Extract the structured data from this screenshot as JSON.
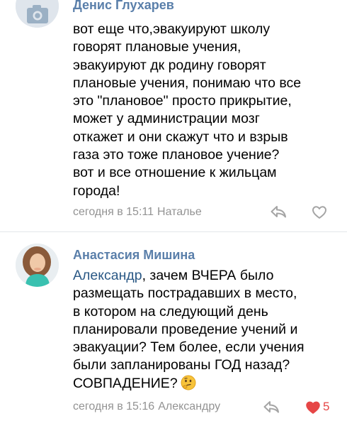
{
  "comments": [
    {
      "author": "Денис Глухарев",
      "text_lines": [
        "вот еще что,эвакуируют школу",
        "говорят плановые учения,",
        "эвакуируют дк родину говорят",
        "плановые учения, понимаю что все",
        "это \"плановое\" просто прикрытие,",
        "может у администрации мозг",
        "откажет и они скажут что и взрыв",
        "газа это тоже плановое учение?",
        "вот и все отношение к жильцам",
        "города!"
      ],
      "time": "сегодня в 15:11",
      "reply_to": "Натальe",
      "avatar_icon": "camera-icon",
      "liked": false
    },
    {
      "author": "Анастасия Мишина",
      "mention": "Александр",
      "text_line1_rest": ", зачем ВЧЕРА было",
      "text_lines": [
        "размещать пострадавших в место,",
        "в котором на следующий день",
        "планировали проведение учений и",
        "эвакуации? Тем более, если учения",
        "были запланированы ГОД назад?"
      ],
      "last_line": "СОВПАДЕНИЕ?",
      "emoji": "thinking-face-emoji",
      "time": "сегодня в 15:16",
      "reply_to": "Александру",
      "likes": "5",
      "liked": true
    }
  ],
  "colors": {
    "author": "#5a7faa",
    "mention": "#2a5885",
    "meta": "#939393",
    "like_active": "#e64646",
    "divider": "#e3e6ea"
  }
}
